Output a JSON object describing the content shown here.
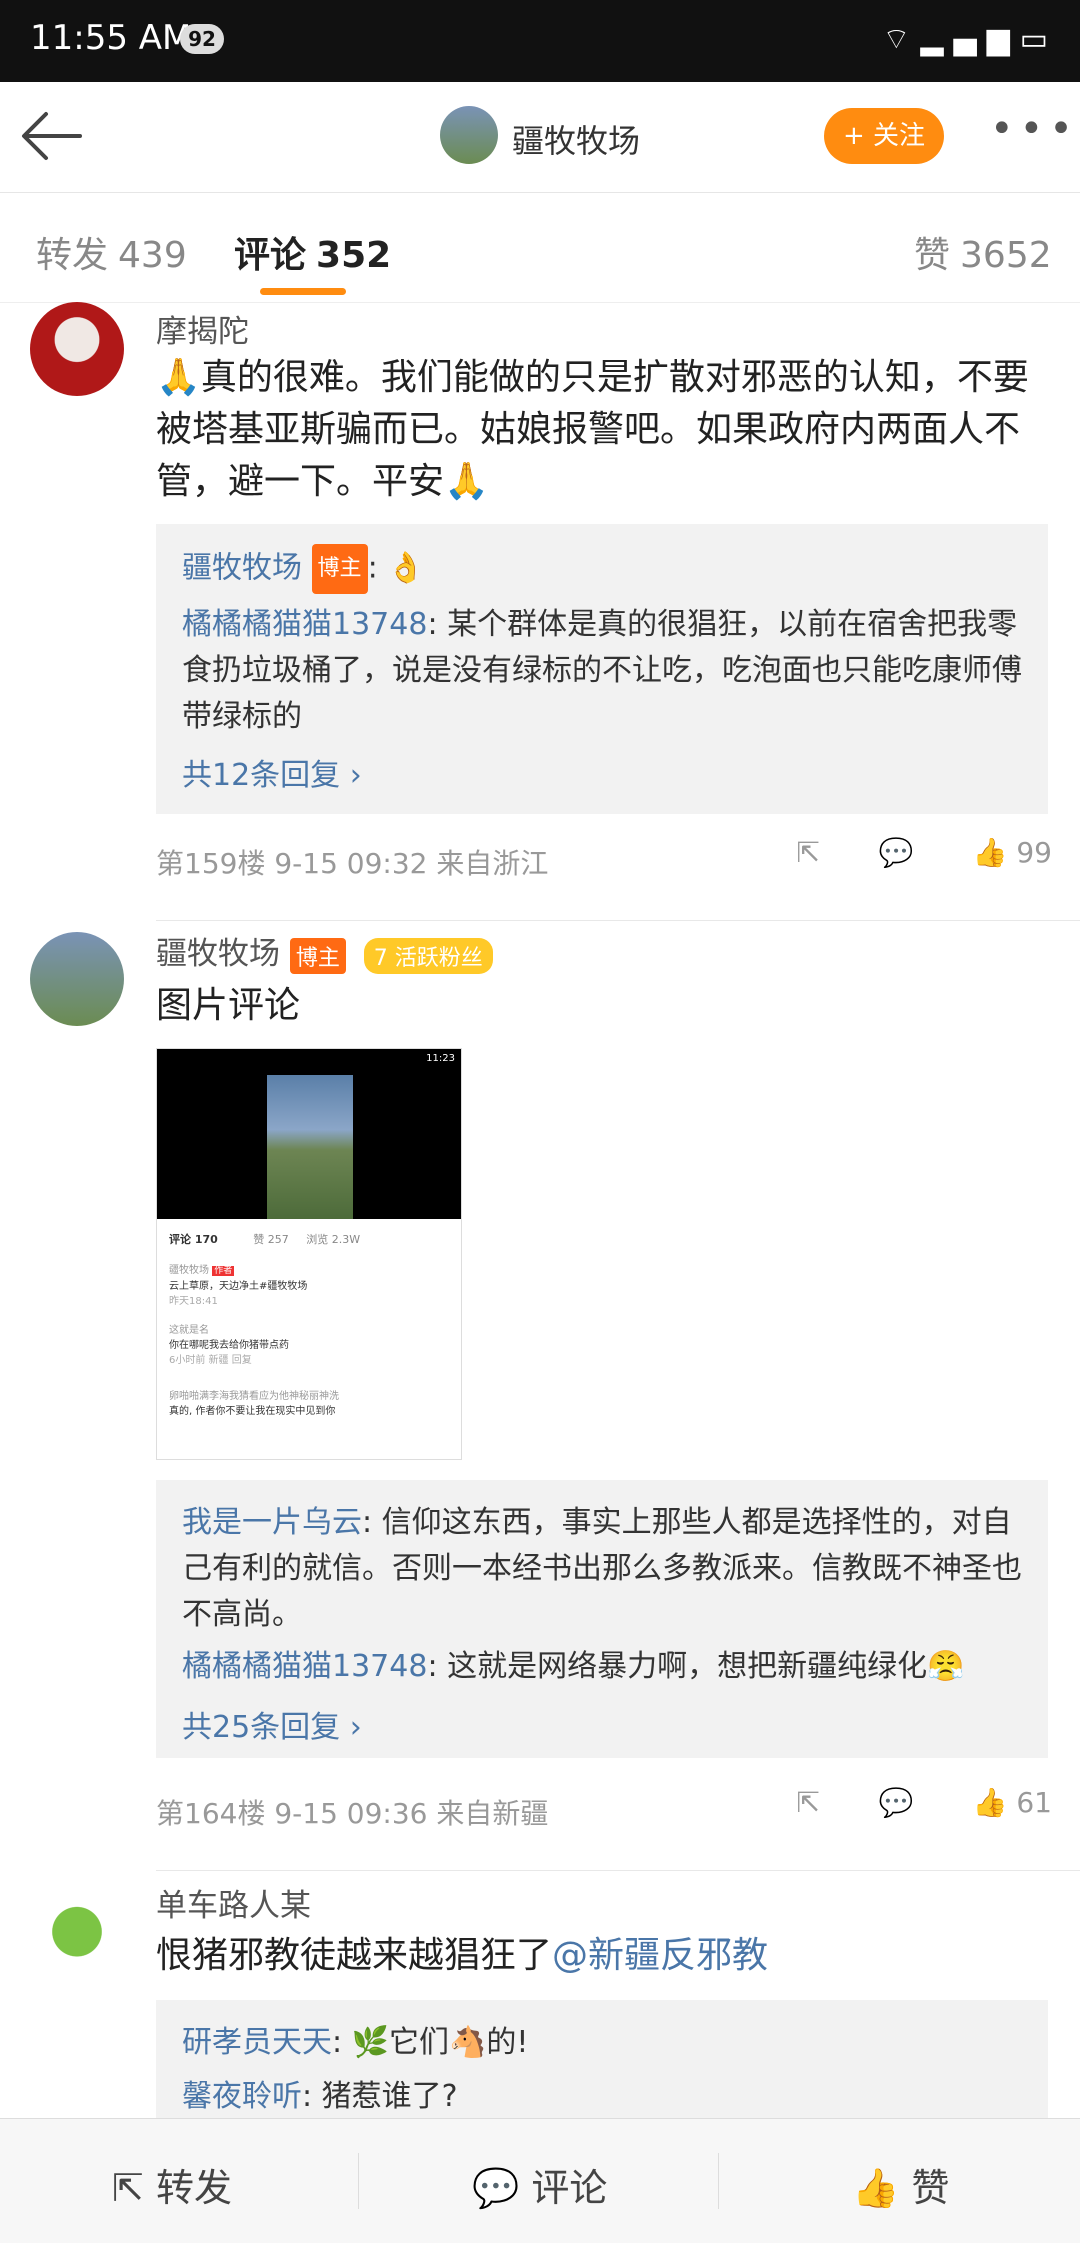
{
  "status_bar": {
    "time": "11:55 AM",
    "badge": "92"
  },
  "nav": {
    "title": "疆牧牧场",
    "follow_label": "+ 关注",
    "more": "•••"
  },
  "tabs": [
    {
      "label": "转发",
      "count": "439"
    },
    {
      "label": "评论",
      "count": "352"
    },
    {
      "label": "赞",
      "count": "3652"
    }
  ],
  "comments": [
    {
      "user": "摩揭陀",
      "text": "🙏真的很难。我们能做的只是扩散对邪恶的认知，不要被塔基亚斯骗而已。姑娘报警吧。如果政府内两面人不管，避一下。平安🙏",
      "replies": [
        {
          "name": "疆牧牧场",
          "tag": "博主",
          "text": ": 👌"
        },
        {
          "name": "橘橘橘猫猫13748",
          "text": ": 某个群体是真的很猖狂，以前在宿舍把我零食扔垃圾桶了，说是没有绿标的不让吃，吃泡面也只能吃康师傅带绿标的"
        }
      ],
      "more_replies": "共12条回复 ›",
      "floor": "第159楼",
      "time": "9-15 09:32",
      "from": "来自浙江",
      "likes": "99"
    },
    {
      "user": "疆牧牧场",
      "tag": "博主",
      "fan_badge": "7 活跃粉丝",
      "text": "图片评论",
      "replies": [
        {
          "name": "我是一片乌云",
          "text": ": 信仰这东西，事实上那些人都是选择性的，对自己有利的就信。否则一本经书出那么多教派来。信教既不神圣也不高尚。"
        },
        {
          "name": "橘橘橘猫猫13748",
          "text": ": 这就是网络暴力啊，想把新疆纯绿化😤"
        }
      ],
      "more_replies": "共25条回复 ›",
      "floor": "第164楼",
      "time": "9-15 09:36",
      "from": "来自新疆",
      "likes": "61"
    },
    {
      "user": "单车路人某",
      "text": "恨猪邪教徒越来越猖狂了",
      "mention": "@新疆反邪教",
      "replies": [
        {
          "name": "研孝员天天",
          "text": ": 🌿它们🐴的!"
        },
        {
          "name": "馨夜聆听",
          "text": ": 猪惹谁了?"
        }
      ]
    }
  ],
  "screenshot_in_comment": {
    "status_time": "11:23",
    "tab_comments": "评论 170",
    "tab_likes": "赞 257",
    "tab_views": "浏览 2.3W",
    "entries": [
      {
        "name": "疆牧牧场",
        "tag": "作者",
        "text": "云上草原，天边净土#疆牧牧场",
        "time": "昨天18:41"
      },
      {
        "name": "这就是名",
        "text": "你在哪呢我去给你猪带点药",
        "time": "6小时前  新疆  回复"
      },
      {
        "name": "卵啪啪满李海我猜看应为他神秘丽神洗",
        "text": "真的, 作者你不要让我在现实中见到你"
      }
    ]
  },
  "bottom_bar": {
    "repost": "转发",
    "comment": "评论",
    "like": "赞"
  },
  "colors": {
    "accent": "#ff8c10",
    "link": "#4a76a8",
    "host_tag": "#ff6a13"
  }
}
